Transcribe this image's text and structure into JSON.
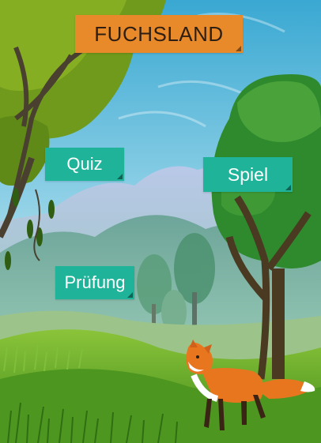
{
  "title": {
    "text": "FUCHSLAND",
    "bg_color": "#e8892a",
    "text_color": "#2e1f12"
  },
  "buttons": {
    "quiz": {
      "label": "Quiz",
      "color": "#1fb39a"
    },
    "spiel": {
      "label": "Spiel",
      "color": "#1fb39a"
    },
    "pruefung": {
      "label": "Prüfung",
      "color": "#1fb39a"
    }
  },
  "scene": {
    "sky_color": "#43b0d6",
    "grass_color": "#4f9a1f",
    "fox_color": "#e8761f",
    "icons": [
      "tree-icon",
      "fox-icon",
      "mountain-icon"
    ]
  }
}
